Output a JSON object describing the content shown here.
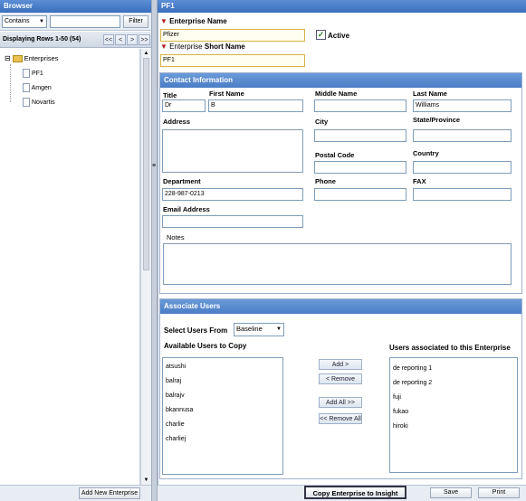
{
  "browser": {
    "title": "Browser",
    "filter_mode": "Contains",
    "filter_value": "",
    "filter_button": "Filter",
    "rows_label": "Displaying Rows 1-50 (54)",
    "pager": [
      "<<",
      "<",
      ">",
      ">>"
    ],
    "tree_root": "Enterprises",
    "tree_expander": "⊟",
    "tree_items": [
      "PF1",
      "Amgen",
      "Novartis"
    ],
    "add_button": "Add New Enterprise",
    "splitter_grip": "≡"
  },
  "form": {
    "title": "PF1",
    "name_label": "Enterprise Name",
    "name_value": "Pfizer",
    "active_label": "Active",
    "active_checked": true,
    "short_name_label_1": "Enterprise",
    "short_name_label_2": "Short Name",
    "short_name_value": "PF1",
    "required_icon": "funnel-icon"
  },
  "contact": {
    "header": "Contact Information",
    "title_label": "Title",
    "title_value": "Dr",
    "first_label": "First Name",
    "first_value": "B",
    "middle_label": "Middle Name",
    "middle_value": "",
    "last_label": "Last Name",
    "last_value": "Williams",
    "address_label": "Address",
    "address_value": "",
    "city_label": "City",
    "city_value": "",
    "state_label": "State/Province",
    "state_value": "",
    "postal_label": "Postal Code",
    "postal_value": "",
    "country_label": "Country",
    "country_value": "",
    "dept_label": "Department",
    "dept_value": "228-987-0213",
    "phone_label": "Phone",
    "phone_value": "",
    "fax_label": "FAX",
    "fax_value": "",
    "email_label": "Email Address",
    "email_value": "",
    "notes_label": "Notes",
    "notes_value": ""
  },
  "users": {
    "header": "Associate Users",
    "select_label": "Select Users From",
    "select_value": "Baseline",
    "available_label": "Available Users to Copy",
    "available": [
      "atsushi",
      "balraj",
      "balrajv",
      "bkannusa",
      "charlie",
      "charliej"
    ],
    "associated_label": "Users associated to this Enterprise",
    "associated": [
      "de reporting 1",
      "de reporting 2",
      "fuji",
      "fukao",
      "hiroki"
    ],
    "add": "Add >",
    "remove": "< Remove",
    "add_all": "Add All >>",
    "remove_all": "<< Remove All"
  },
  "footer": {
    "copy": "Copy Enterprise to Insight",
    "save": "Save",
    "print": "Print"
  },
  "colors": {
    "header_blue": "#3a6fbe",
    "section_blue": "#4a7dc6",
    "required_red": "#b02020",
    "active_green": "#2a8a2a"
  }
}
